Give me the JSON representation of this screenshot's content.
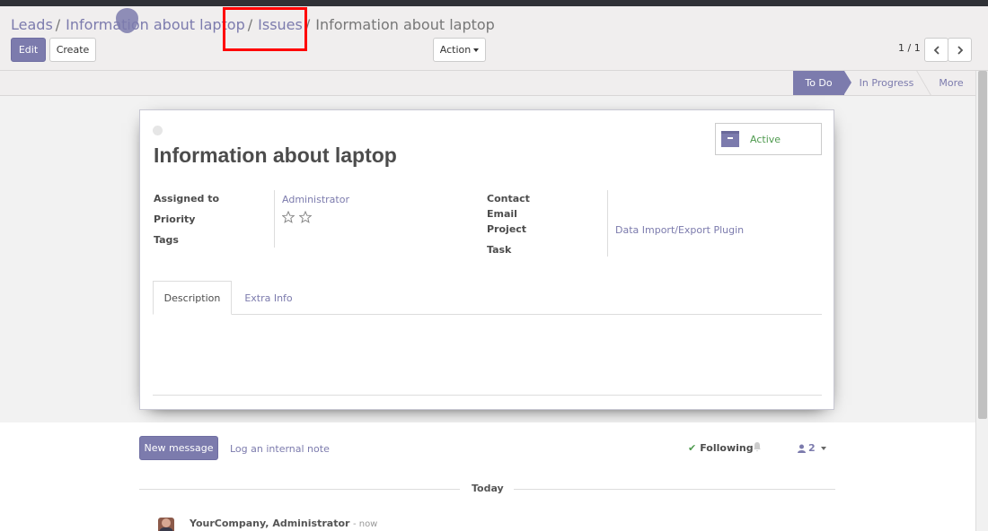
{
  "breadcrumb": {
    "items": [
      "Leads",
      "Information about laptop",
      "Issues"
    ],
    "separator": "/",
    "current": "Information about laptop"
  },
  "toolbar": {
    "edit_label": "Edit",
    "create_label": "Create",
    "action_label": "Action"
  },
  "pager": {
    "value": "1 / 1"
  },
  "statusbar": {
    "stages": [
      "To Do",
      "In Progress",
      "More"
    ],
    "current_stage": "To Do"
  },
  "record": {
    "title": "Information about laptop",
    "status_button": "Active",
    "fields_left": {
      "assigned_to_label": "Assigned to",
      "assigned_to_value": "Administrator",
      "priority_label": "Priority",
      "priority_stars": 0,
      "priority_max": 2,
      "tags_label": "Tags"
    },
    "fields_right": {
      "contact_label": "Contact",
      "email_label": "Email",
      "project_label": "Project",
      "project_value": "Data Import/Export Plugin",
      "task_label": "Task"
    },
    "tabs": [
      "Description",
      "Extra Info"
    ],
    "active_tab": "Description"
  },
  "chatter": {
    "new_message_label": "New message",
    "log_note_label": "Log an internal note",
    "following_label": "Following",
    "followers_count": "2",
    "date_separator": "Today",
    "message": {
      "author": "YourCompany, Administrator",
      "time": "- now"
    }
  },
  "colors": {
    "accent": "#7c7bad",
    "highlight": "#ff0000",
    "success": "#4e9a4e"
  }
}
